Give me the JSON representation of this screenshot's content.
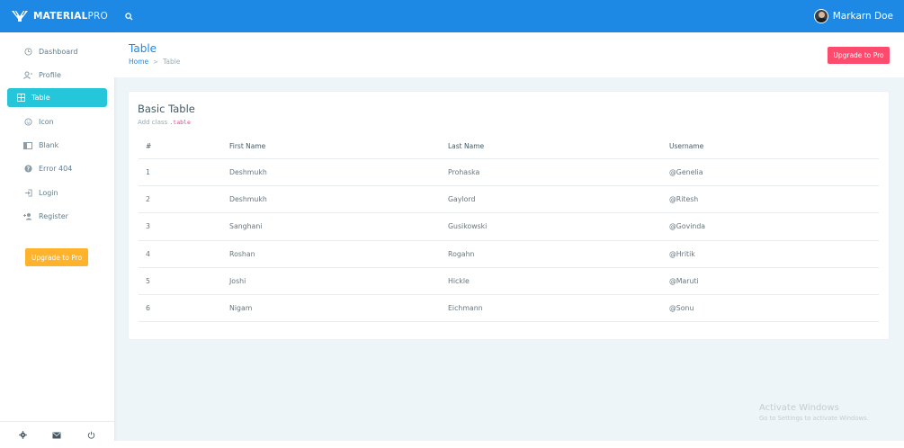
{
  "brand": {
    "name_bold": "MATERIAL",
    "name_light": "PRO",
    "accent": "#1e88e5"
  },
  "topbar": {
    "search_icon": "search-icon",
    "user_name": "Markarn Doe"
  },
  "sidebar": {
    "items": [
      {
        "label": "Dashboard",
        "icon": "dashboard-icon"
      },
      {
        "label": "Profile",
        "icon": "profile-icon"
      },
      {
        "label": "Table",
        "icon": "table-icon",
        "active": true
      },
      {
        "label": "Icon",
        "icon": "smiley-icon"
      },
      {
        "label": "Blank",
        "icon": "blank-page-icon"
      },
      {
        "label": "Error 404",
        "icon": "help-icon"
      },
      {
        "label": "Login",
        "icon": "login-icon"
      },
      {
        "label": "Register",
        "icon": "register-icon"
      }
    ],
    "upgrade_label": "Upgrade to Pro",
    "footer_icons": [
      "gear-icon",
      "mail-icon",
      "power-icon"
    ]
  },
  "page": {
    "title": "Table",
    "breadcrumb": {
      "home": "Home",
      "separator": ">",
      "current": "Table"
    },
    "upgrade_label": "Upgrade to Pro"
  },
  "card": {
    "title": "Basic Table",
    "subtitle_prefix": "Add class",
    "subtitle_code": ".table",
    "columns": [
      "#",
      "First Name",
      "Last Name",
      "Username"
    ],
    "rows": [
      [
        "1",
        "Deshmukh",
        "Prohaska",
        "@Genelia"
      ],
      [
        "2",
        "Deshmukh",
        "Gaylord",
        "@Ritesh"
      ],
      [
        "3",
        "Sanghani",
        "Gusikowski",
        "@Govinda"
      ],
      [
        "4",
        "Roshan",
        "Rogahn",
        "@Hritik"
      ],
      [
        "5",
        "Joshi",
        "Hickle",
        "@Maruti"
      ],
      [
        "6",
        "Nigam",
        "Eichmann",
        "@Sonu"
      ]
    ]
  },
  "watermark": {
    "title": "Activate Windows",
    "subtitle": "Go to Settings to activate Windows."
  },
  "colors": {
    "active_nav": "#26c6da",
    "upgrade_side": "#ffb22b",
    "upgrade_top": "#fc4b6c",
    "topbar": "#1e88e5"
  }
}
